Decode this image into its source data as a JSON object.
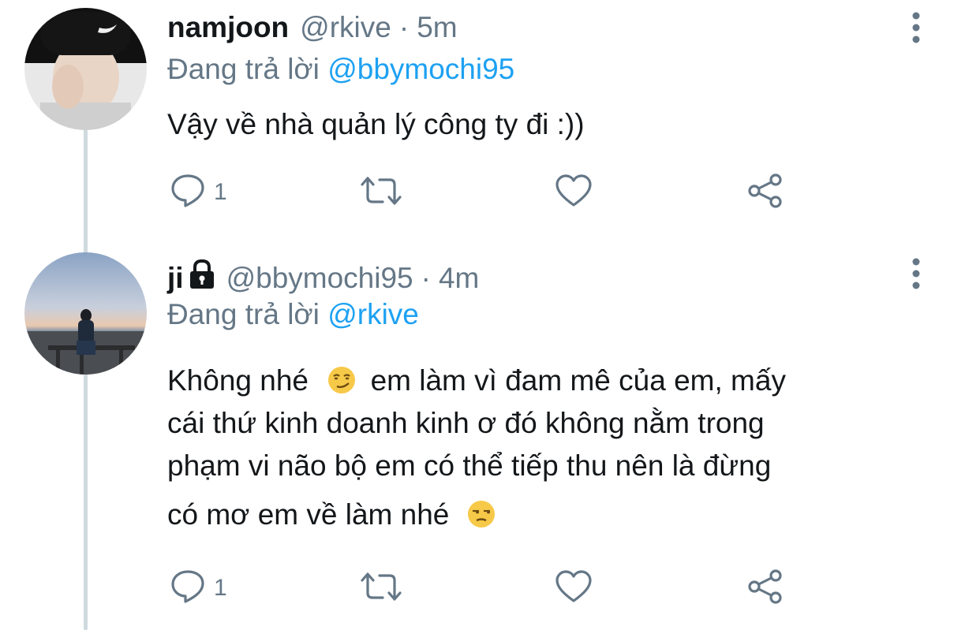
{
  "tweets": [
    {
      "name": "namjoon",
      "handle": "@rkive",
      "separator": "·",
      "time": "5m",
      "replying_prefix": "Đang trả lời",
      "replying_to": "@bbymochi95",
      "body_lines": [
        "Vậy về nhà quản lý công ty đi :))"
      ],
      "reply_count": "1",
      "locked": false
    },
    {
      "name": "ji",
      "handle": "@bbymochi95",
      "separator": "·",
      "time": "4m",
      "replying_prefix": "Đang trả lời",
      "replying_to": "@rkive",
      "body_lines": [
        "Không nhé",
        " em làm vì đam mê của em, mấy",
        "cái thứ kinh doanh kinh ơ đó không nằm trong",
        "phạm vi não bộ em có thể tiếp thu nên là đừng",
        "có mơ em về làm nhé"
      ],
      "emojis": [
        "smirking-face",
        "unamused-face"
      ],
      "reply_count": "1",
      "locked": true
    }
  ],
  "icons": {
    "reply": "comment-icon",
    "retweet": "retweet-icon",
    "like": "heart-icon",
    "share": "share-icon",
    "more": "more-vertical-icon",
    "lock": "lock-icon"
  },
  "colors": {
    "text": "#14171a",
    "muted": "#657786",
    "link": "#1da1f2",
    "thread": "#cfd9de"
  }
}
